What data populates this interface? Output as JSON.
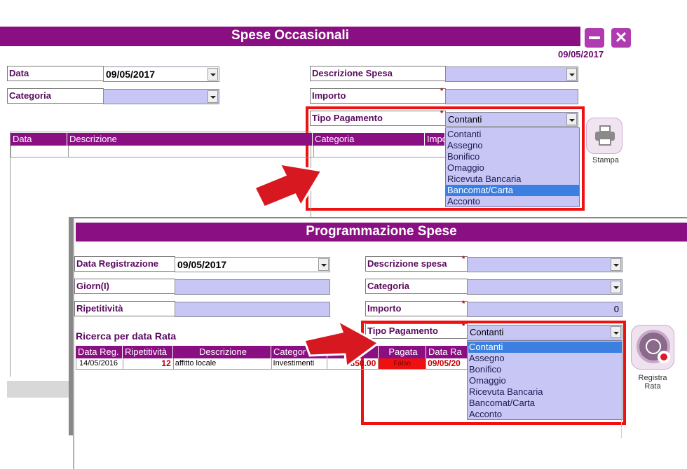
{
  "back": {
    "title": "Spese Occasionali",
    "date_display": "09/05/2017",
    "data_label": "Data",
    "data_value": "09/05/2017",
    "categoria_label": "Categoria",
    "descrizione_label": "Descrizione Spesa",
    "importo_label": "Importo",
    "tipo_pagamento_label": "Tipo Pagamento",
    "tipo_pagamento_value": "Contanti",
    "required_mark": "*",
    "payment_options": [
      "Contanti",
      "Assegno",
      "Bonifico",
      "Omaggio",
      "Ricevuta Bancaria",
      "Bancomat/Carta",
      "Acconto"
    ],
    "selected_option": "Bancomat/Carta",
    "table_headers": [
      "Data",
      "Descrizione",
      "Categoria",
      "Impo"
    ],
    "stampa_label": "Stampa"
  },
  "front": {
    "title": "Programmazione Spese",
    "data_reg_label": "Data Registrazione",
    "data_reg_value": "09/05/2017",
    "giorni_label": "Giorn(I)",
    "ripetitivita_label": "Ripetitività",
    "descrizione_label": "Descrizione spesa",
    "categoria_label": "Categoria",
    "importo_label": "Importo",
    "importo_value": "0",
    "tipo_pagamento_label": "Tipo Pagamento",
    "tipo_pagamento_value": "Contanti",
    "required_mark": "*",
    "payment_options": [
      "Contanti",
      "Assegno",
      "Bonifico",
      "Omaggio",
      "Ricevuta Bancaria",
      "Bancomat/Carta",
      "Acconto"
    ],
    "selected_option": "Contanti",
    "search_label": "Ricerca per data Rata",
    "table_headers": [
      "Data Reg.",
      "Ripetitività",
      "Descrizione",
      "Categor",
      "",
      "Pagata",
      "Data Ra"
    ],
    "row": {
      "data_reg": "14/05/2016",
      "ripetitivita": "12",
      "descrizione": "affitto locale",
      "categoria": "Investimenti",
      "importo": "850.00",
      "pagata": "Falso",
      "data_rata": "09/05/20"
    },
    "registra_label": "Registra\nRata"
  },
  "colors": {
    "accent": "#8a0f82",
    "field": "#c8c6f5",
    "highlight": "#ee1111"
  }
}
